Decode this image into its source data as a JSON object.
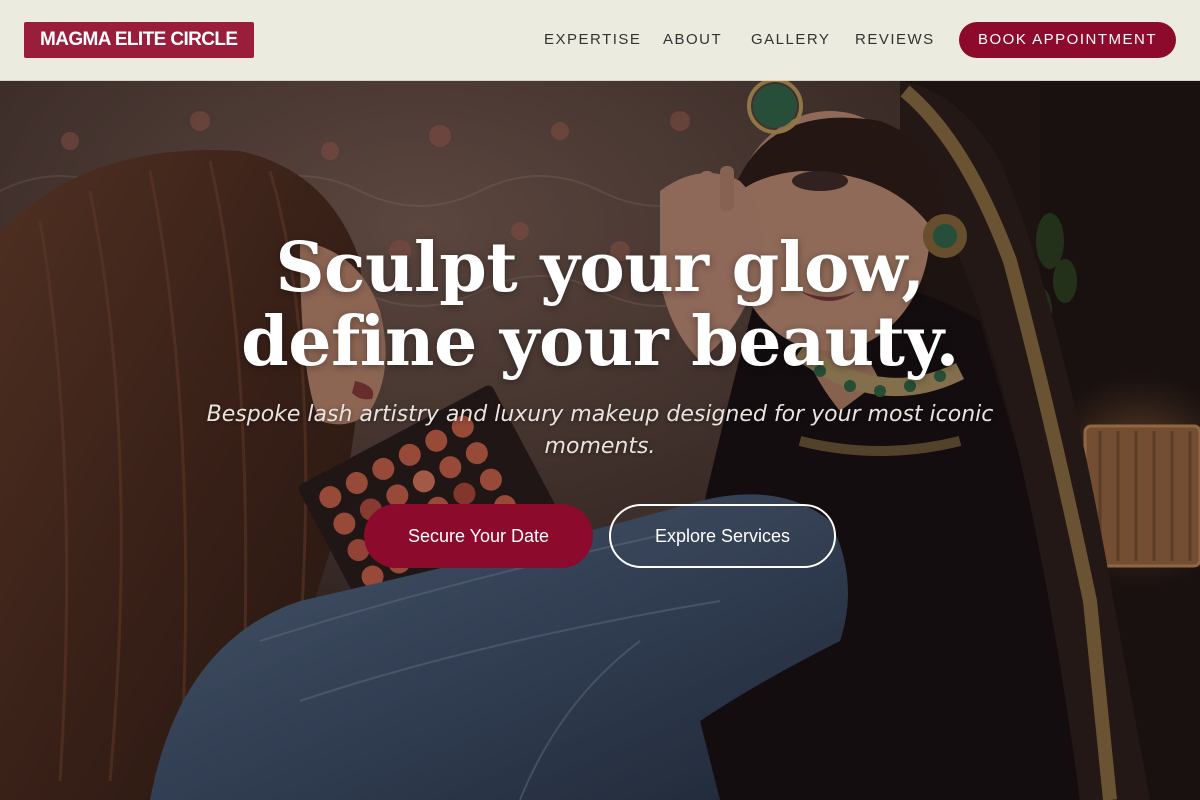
{
  "header": {
    "logo": "MAGMA ELITE CIRCLE",
    "nav": [
      "EXPERTISE",
      "ABOUT",
      "GALLERY",
      "REVIEWS"
    ],
    "cta": "BOOK APPOINTMENT"
  },
  "hero": {
    "headline": "Sculpt your glow, define your beauty.",
    "subtitle": "Bespoke lash artistry and luxury makeup designed for your most iconic moments.",
    "primary_button": "Secure Your Date",
    "secondary_button": "Explore Services",
    "background_image": "makeup-artist-applying-bridal-makeup-photo"
  },
  "colors": {
    "header_bg": "#ecebdf",
    "brand": "#9a1d3b",
    "accent": "#8c0a2c",
    "text_light": "#ffffff"
  }
}
